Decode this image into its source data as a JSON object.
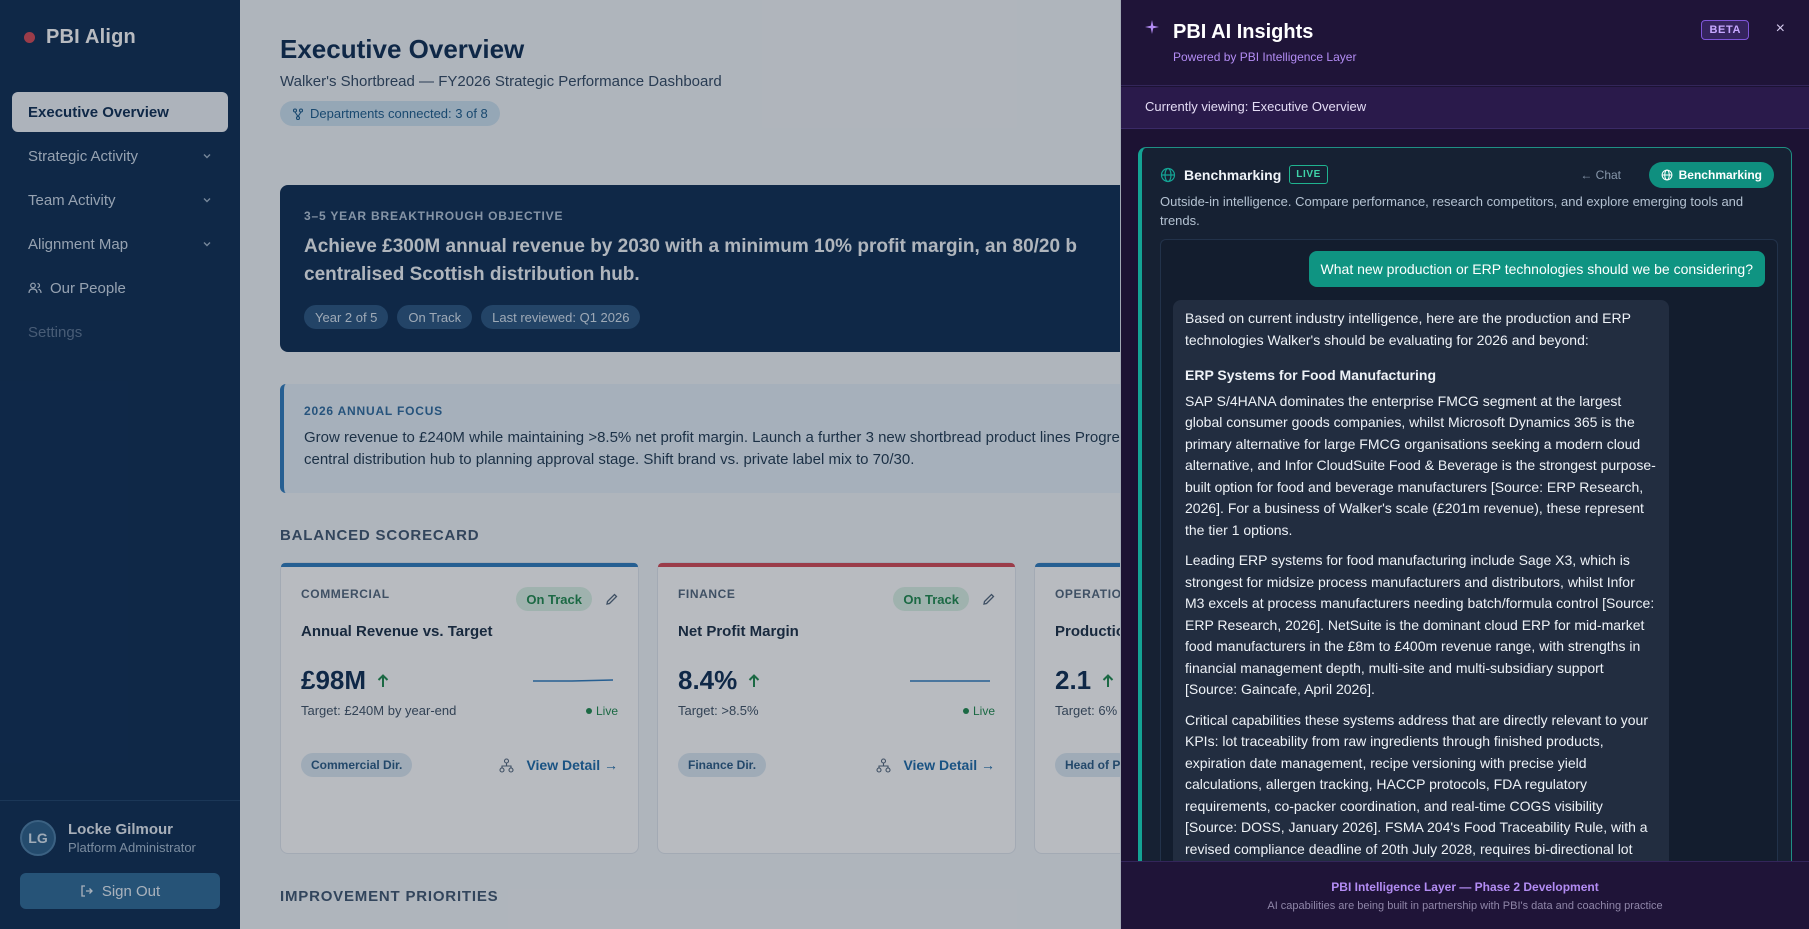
{
  "brand": {
    "name": "PBI Align",
    "dot_color": "#d64a55"
  },
  "sidebar": {
    "items": [
      {
        "label": "Executive Overview",
        "active": true,
        "has_chevron": false
      },
      {
        "label": "Strategic Activity",
        "active": false,
        "has_chevron": true
      },
      {
        "label": "Team Activity",
        "active": false,
        "has_chevron": true
      },
      {
        "label": "Alignment Map",
        "active": false,
        "has_chevron": true
      },
      {
        "label": "Our People",
        "active": false,
        "has_chevron": false,
        "icon": "people-icon"
      },
      {
        "label": "Settings",
        "active": false,
        "has_chevron": false,
        "muted": true
      }
    ],
    "user": {
      "initials": "LG",
      "name": "Locke Gilmour",
      "role": "Platform Administrator"
    },
    "signout_label": "Sign Out"
  },
  "main": {
    "title": "Executive Overview",
    "subtitle": "Walker's Shortbread — FY2026 Strategic Performance Dashboard",
    "departments_pill": "Departments connected: 3 of 8",
    "objective": {
      "kicker": "3–5 YEAR BREAKTHROUGH OBJECTIVE",
      "text": "Achieve £300M annual revenue by 2030 with a minimum 10% profit margin, an 80/20 b centralised Scottish distribution hub.",
      "tags": [
        "Year 2 of 5",
        "On Track",
        "Last reviewed: Q1 2026"
      ]
    },
    "focus": {
      "kicker": "2026 ANNUAL FOCUS",
      "text": "Grow revenue to £240M while maintaining >8.5% net profit margin. Launch a further 3 new shortbread product lines Progress central distribution hub to planning approval stage. Shift brand vs. private label mix to 70/30."
    },
    "scorecard_heading": "BALANCED SCORECARD",
    "improvement_heading": "IMPROVEMENT PRIORITIES",
    "cards": [
      {
        "dept": "COMMERCIAL",
        "status": "On Track",
        "title": "Annual Revenue vs. Target",
        "value": "£98M",
        "target": "Target: £240M by year-end",
        "live": "Live",
        "owner": "Commercial Dir.",
        "detail": "View Detail →",
        "accent": "#2e7bbd"
      },
      {
        "dept": "FINANCE",
        "status": "On Track",
        "title": "Net Profit Margin",
        "value": "8.4%",
        "target": "Target: >8.5%",
        "live": "Live",
        "owner": "Finance Dir.",
        "detail": "View Detail →",
        "accent": "#d64a55"
      },
      {
        "dept": "OPERATIO",
        "status": "",
        "title": "Productio",
        "value": "2.1",
        "target": "Target: 6% o",
        "live": "",
        "owner": "Head of P",
        "detail": "",
        "accent": "#2e7bbd"
      }
    ]
  },
  "panel": {
    "title": "PBI AI Insights",
    "subtitle": "Powered by PBI Intelligence Layer",
    "beta": "BETA",
    "close": "×",
    "viewing": "Currently viewing: Executive Overview",
    "benchmarking": {
      "title": "Benchmarking",
      "live": "LIVE",
      "chat_link": "← Chat",
      "button": "Benchmarking",
      "description": "Outside-in intelligence. Compare performance, research competitors, and explore emerging tools and trends.",
      "user_message": "What new production or ERP technologies should we be considering?",
      "ai_intro": "Based on current industry intelligence, here are the production and ERP technologies Walker's should be evaluating for 2026 and beyond:",
      "ai_heading": "ERP Systems for Food Manufacturing",
      "ai_p1": "SAP S/4HANA dominates the enterprise FMCG segment at the largest global consumer goods companies, whilst Microsoft Dynamics 365 is the primary alternative for large FMCG organisations seeking a modern cloud alternative, and Infor CloudSuite Food & Beverage is the strongest purpose-built option for food and beverage manufacturers [Source: ERP Research, 2026]. For a business of Walker's scale (£201m revenue), these represent the tier 1 options.",
      "ai_p2": "Leading ERP systems for food manufacturing include Sage X3, which is strongest for midsize process manufacturers and distributors, whilst Infor M3 excels at process manufacturers needing batch/formula control [Source: ERP Research, 2026]. NetSuite is the dominant cloud ERP for mid-market food manufacturers in the £8m to £400m revenue range, with strengths in financial management depth, multi-site and multi-subsidiary support [Source: Gaincafe, April 2026].",
      "ai_p3": "Critical capabilities these systems address that are directly relevant to your KPIs: lot traceability from raw ingredients through finished products, expiration date management, recipe versioning with precise yield calculations, allergen tracking, HACCP protocols, FDA regulatory requirements, co-packer coordination, and real-time COGS visibility [Source: DOSS, January 2026]. FSMA 204's Food Traceability Rule, with a revised compliance deadline of 20th July 2028, requires bi-directional lot"
    },
    "footer_title": "PBI Intelligence Layer — Phase 2 Development",
    "footer_sub": "AI capabilities are being built in partnership with PBI's data and coaching practice",
    "accent_color": "#0f8f7f",
    "brand_purple": "#b38cf4"
  }
}
